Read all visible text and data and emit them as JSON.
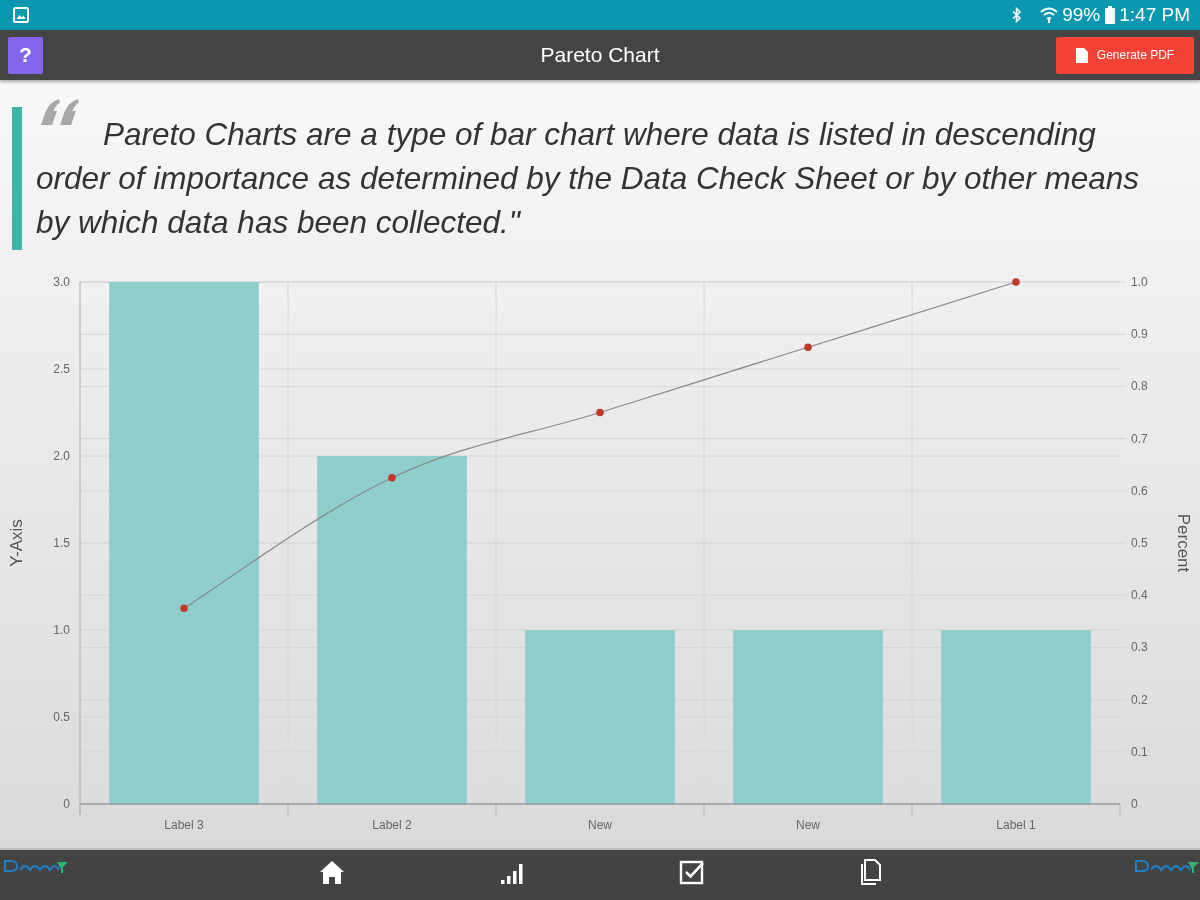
{
  "status_bar": {
    "battery": "99%",
    "time": "1:47 PM"
  },
  "header": {
    "help_button": "?",
    "title": "Pareto Chart",
    "pdf_button": "Generate PDF"
  },
  "quote": {
    "text": "Pareto Charts are a type of bar chart where data is listed in descending order of importance as determined by the Data Check Sheet or by other means by which data has been collected.\""
  },
  "chart": {
    "chart_data": [
      {
        "type": "bar",
        "categories": [
          "Label 3",
          "Label 2",
          "New",
          "New",
          "Label 1"
        ],
        "ylabel": "Y-Axis",
        "y2label": "Percent",
        "ylim": [
          0,
          3
        ],
        "y2lim": [
          0,
          1
        ],
        "yticks": [
          {
            "value": 0,
            "label": "0"
          },
          {
            "value": 0.5,
            "label": "0.5"
          },
          {
            "value": 1,
            "label": "1.0"
          },
          {
            "value": 1.5,
            "label": "1.5"
          },
          {
            "value": 2,
            "label": "2.0"
          },
          {
            "value": 2.5,
            "label": "2.5"
          },
          {
            "value": 3,
            "label": "3.0"
          }
        ],
        "y2ticks": [
          {
            "value": 0,
            "label": "0"
          },
          {
            "value": 0.1,
            "label": "0.1"
          },
          {
            "value": 0.2,
            "label": "0.2"
          },
          {
            "value": 0.3,
            "label": "0.3"
          },
          {
            "value": 0.4,
            "label": "0.4"
          },
          {
            "value": 0.5,
            "label": "0.5"
          },
          {
            "value": 0.6,
            "label": "0.6"
          },
          {
            "value": 0.7,
            "label": "0.7"
          },
          {
            "value": 0.8,
            "label": "0.8"
          },
          {
            "value": 0.9,
            "label": "0.9"
          },
          {
            "value": 1,
            "label": "1.0"
          }
        ],
        "grid": true,
        "marker": "circle",
        "series": [
          {
            "color": "#8ecfcd",
            "values": [
              3,
              2,
              1,
              1,
              1
            ]
          },
          {
            "type": "line",
            "axis": "y2",
            "color": "#8a8a8a",
            "values": [
              0.375,
              0.625,
              0.75,
              0.875,
              1
            ]
          }
        ]
      }
    ]
  }
}
